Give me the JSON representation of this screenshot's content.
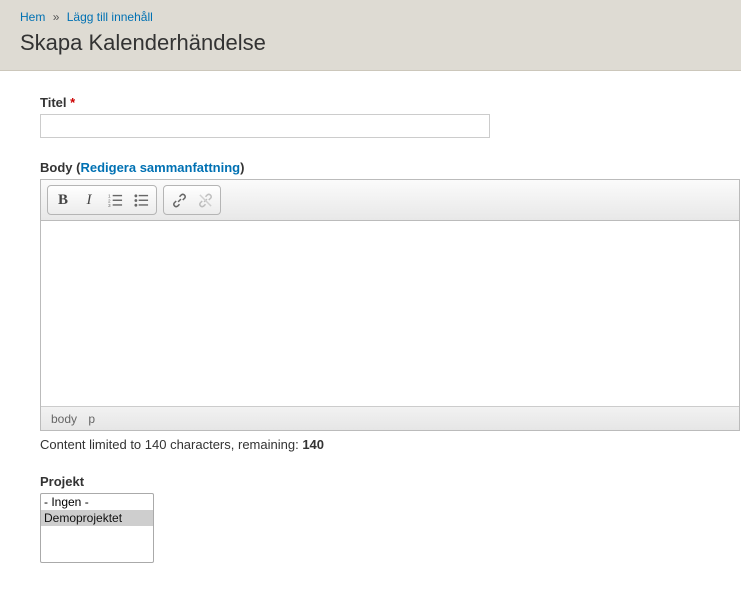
{
  "breadcrumb": {
    "home": "Hem",
    "add_content": "Lägg till innehåll"
  },
  "page_title": "Skapa Kalenderhändelse",
  "fields": {
    "title": {
      "label": "Titel",
      "value": ""
    },
    "body": {
      "label_prefix": "Body (",
      "edit_summary_link": "Redigera sammanfattning",
      "label_suffix": ")",
      "toolbar": {
        "bold": "B",
        "italic": "I",
        "ol": "ordered-list",
        "ul": "unordered-list",
        "link": "link",
        "unlink": "unlink"
      },
      "status_path": [
        "body",
        "p"
      ],
      "char_limit_text": "Content limited to 140 characters, remaining: ",
      "char_remaining": "140"
    },
    "project": {
      "label": "Projekt",
      "options": [
        "- Ingen -",
        "Demoprojektet"
      ],
      "selected": "Demoprojektet"
    }
  }
}
